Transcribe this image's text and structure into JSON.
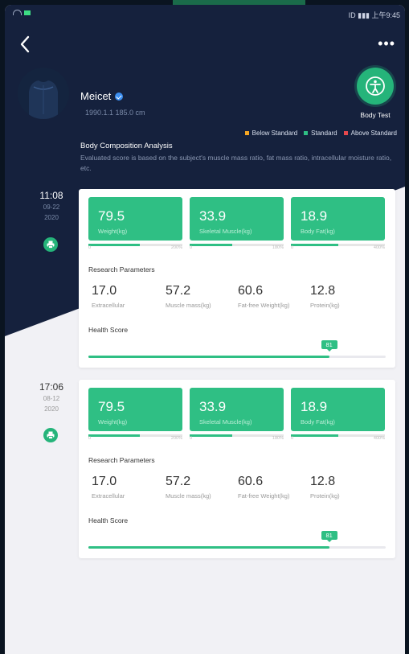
{
  "colors": {
    "navy": "#15213d",
    "green": "#2fbf84",
    "below": "#f5a623",
    "standard": "#2fbf84",
    "above": "#e5484d"
  },
  "status": {
    "right": "ID ▮▮▮ 上午9:45"
  },
  "nav": {
    "back_icon": "chevron-left-icon",
    "more_icon": "more-dots-icon",
    "more_label": "•••",
    "back_label": "<"
  },
  "profile": {
    "name": "Meicet",
    "info": "1990.1.1  185.0 cm"
  },
  "body_test": {
    "label": "Body Test"
  },
  "legend": [
    {
      "label": "Below Standard",
      "color": "#f5a623"
    },
    {
      "label": "Standard",
      "color": "#2fbf84"
    },
    {
      "label": "Above Standard",
      "color": "#e5484d"
    }
  ],
  "analysis": {
    "title": "Body Composition Analysis",
    "desc": "Evaluated score is based on the subject's muscle mass ratio, fat mass ratio, intracellular moisture ratio, etc."
  },
  "records": [
    {
      "time": "11:08",
      "date1": "09-22",
      "date2": "2020",
      "metrics": [
        {
          "value": "79.5",
          "label": "Weight(kg)",
          "min": "0",
          "max": "200%",
          "level": 0.55
        },
        {
          "value": "33.9",
          "label": "Skeletal Muscle(kg)",
          "min": "0",
          "max": "180%",
          "level": 0.45
        },
        {
          "value": "18.9",
          "label": "Body Fat(kg)",
          "min": "0",
          "max": "400%",
          "level": 0.5
        }
      ],
      "research_title": "Research Parameters",
      "params": [
        {
          "value": "17.0",
          "label": "Extracellular"
        },
        {
          "value": "57.2",
          "label": "Muscle mass(kg)"
        },
        {
          "value": "60.6",
          "label": "Fat-free Weight(kg)"
        },
        {
          "value": "12.8",
          "label": "Protein(kg)"
        }
      ],
      "health_title": "Health Score",
      "health_score": "81",
      "health_level": 0.81
    },
    {
      "time": "17:06",
      "date1": "08-12",
      "date2": "2020",
      "metrics": [
        {
          "value": "79.5",
          "label": "Weight(kg)",
          "min": "0",
          "max": "200%",
          "level": 0.55
        },
        {
          "value": "33.9",
          "label": "Skeletal Muscle(kg)",
          "min": "0",
          "max": "180%",
          "level": 0.45
        },
        {
          "value": "18.9",
          "label": "Body Fat(kg)",
          "min": "0",
          "max": "400%",
          "level": 0.5
        }
      ],
      "research_title": "Research Parameters",
      "params": [
        {
          "value": "17.0",
          "label": "Extracellular"
        },
        {
          "value": "57.2",
          "label": "Muscle mass(kg)"
        },
        {
          "value": "60.6",
          "label": "Fat-free Weight(kg)"
        },
        {
          "value": "12.8",
          "label": "Protein(kg)"
        }
      ],
      "health_title": "Health Score",
      "health_score": "81",
      "health_level": 0.81
    }
  ]
}
